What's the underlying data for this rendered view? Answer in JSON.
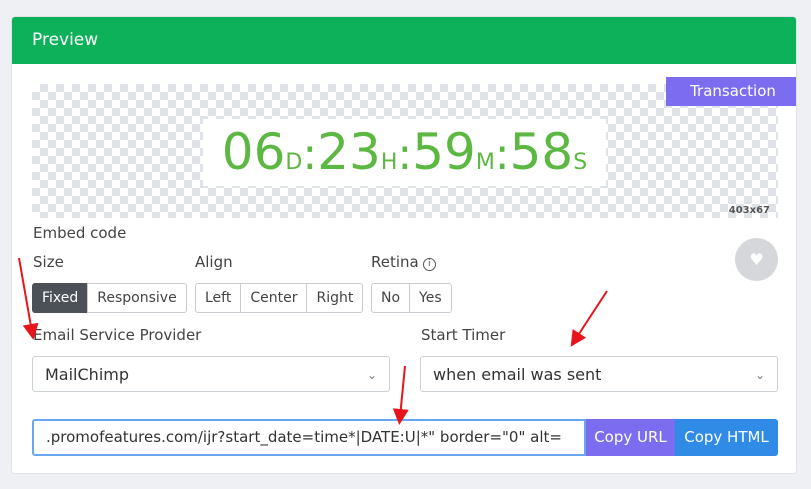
{
  "card": {
    "title": "Preview"
  },
  "preview": {
    "badge": "Transaction",
    "timer": {
      "days": "06",
      "days_unit": "D",
      "hours": "23",
      "hours_unit": "H",
      "minutes": "59",
      "minutes_unit": "M",
      "seconds": "58",
      "seconds_unit": "S",
      "separator": ":"
    },
    "dimensions": "403x67"
  },
  "embed": {
    "title": "Embed code",
    "size": {
      "label": "Size",
      "options": [
        "Fixed",
        "Responsive"
      ],
      "selected": "Fixed"
    },
    "align": {
      "label": "Align",
      "options": [
        "Left",
        "Center",
        "Right"
      ]
    },
    "retina": {
      "label": "Retina",
      "options": [
        "No",
        "Yes"
      ]
    },
    "esp": {
      "label": "Email Service Provider",
      "value": "MailChimp"
    },
    "start_timer": {
      "label": "Start Timer",
      "value": "when email was sent"
    },
    "code_value": ".promofeatures.com/ijr?start_date=time*|DATE:U|*\" border=\"0\" alt=",
    "copy_url": "Copy URL",
    "copy_html": "Copy HTML"
  },
  "colors": {
    "header_green": "#0db15a",
    "timer_green": "#5cb842",
    "badge_purple": "#7b6cf0",
    "copy_html_blue": "#2f8be6",
    "arrow_red": "#e8141b"
  },
  "icons": [
    "heart-icon",
    "info-icon",
    "chevron-down-icon",
    "arrow-annotation"
  ]
}
